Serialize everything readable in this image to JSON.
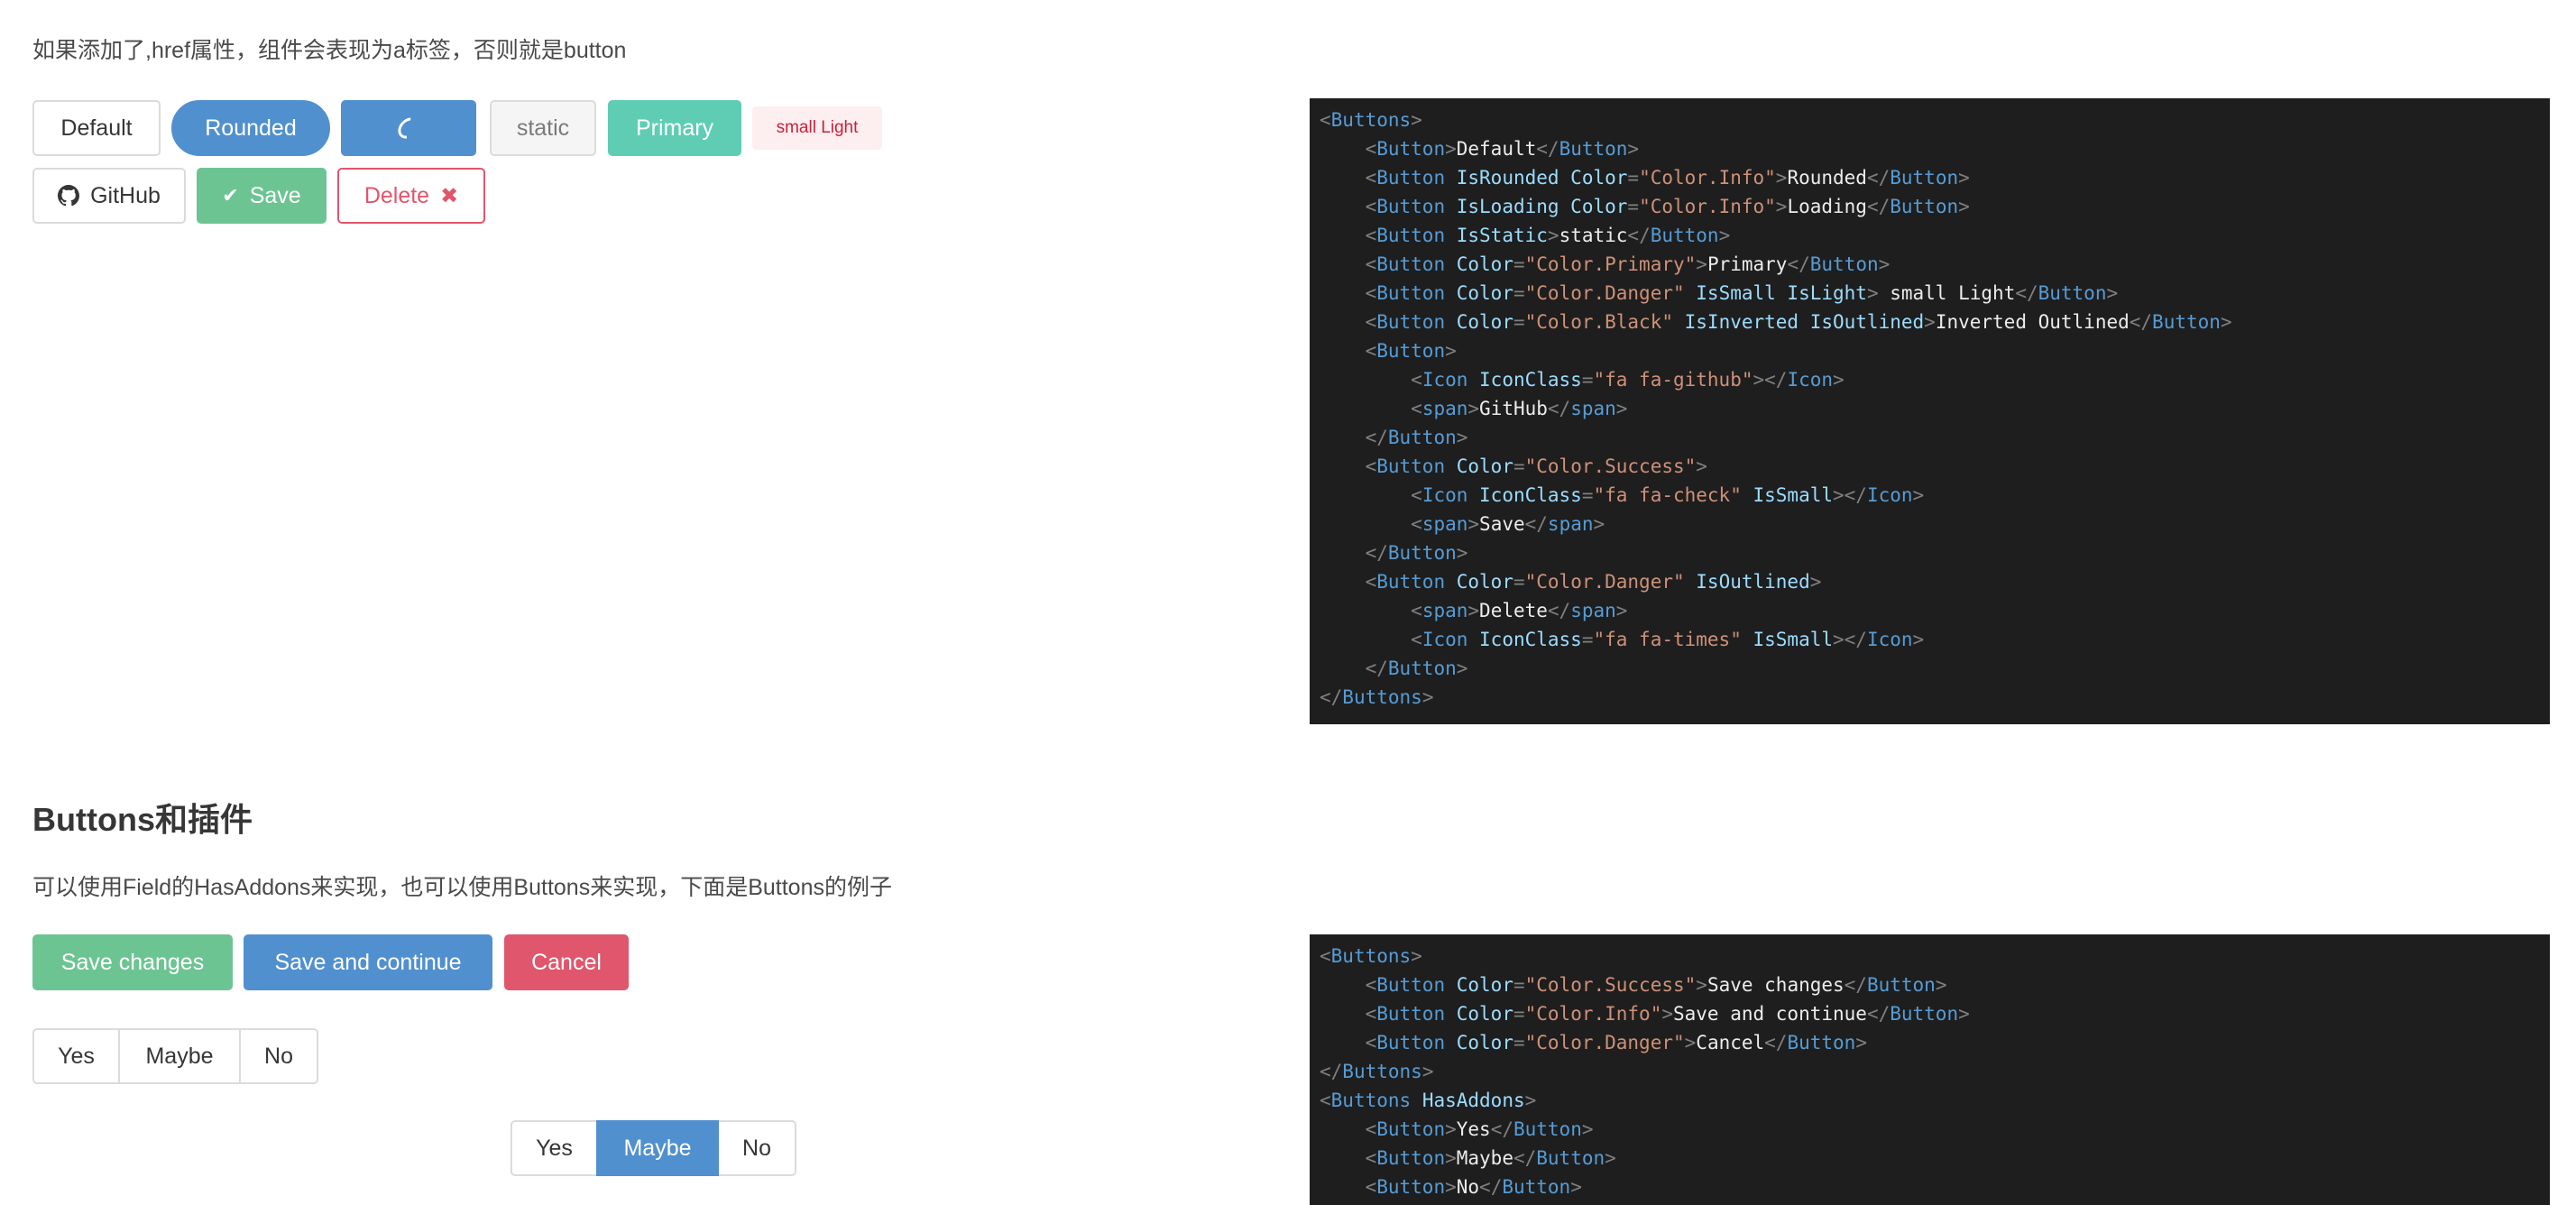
{
  "intro_text": "如果添加了,href属性，组件会表现为a标签，否则就是button",
  "row1": {
    "default": "Default",
    "rounded": "Rounded",
    "static": "static",
    "primary": "Primary",
    "small_light": "small Light"
  },
  "row2": {
    "github": "GitHub",
    "save": "Save",
    "delete": "Delete"
  },
  "section2": {
    "title": "Buttons和插件",
    "desc": "可以使用Field的HasAddons来实现，也可以使用Buttons来实现，下面是Buttons的例子"
  },
  "row3": {
    "save_changes": "Save changes",
    "save_continue": "Save and continue",
    "cancel": "Cancel"
  },
  "addons1": [
    "Yes",
    "Maybe",
    "No"
  ],
  "addons2": {
    "items": [
      "Yes",
      "Maybe",
      "No"
    ],
    "selected": "Maybe"
  },
  "colors": {
    "info": "#5190ce",
    "success": "#6dc493",
    "primary": "#5ecdb4",
    "danger": "#e0566c",
    "code_bg": "#1e1e1e"
  },
  "code1": [
    [
      0,
      [
        [
          "p",
          "<"
        ],
        [
          "t",
          "Buttons"
        ],
        [
          "p",
          ">"
        ]
      ]
    ],
    [
      1,
      [
        [
          "p",
          "<"
        ],
        [
          "t",
          "Button"
        ],
        [
          "p",
          ">"
        ],
        [
          "x",
          "Default"
        ],
        [
          "p",
          "</"
        ],
        [
          "t",
          "Button"
        ],
        [
          "p",
          ">"
        ]
      ]
    ],
    [
      1,
      [
        [
          "p",
          "<"
        ],
        [
          "t",
          "Button "
        ],
        [
          "a",
          "IsRounded Color"
        ],
        [
          "p",
          "="
        ],
        [
          "s",
          "\"Color.Info\""
        ],
        [
          "p",
          ">"
        ],
        [
          "x",
          "Rounded"
        ],
        [
          "p",
          "</"
        ],
        [
          "t",
          "Button"
        ],
        [
          "p",
          ">"
        ]
      ]
    ],
    [
      1,
      [
        [
          "p",
          "<"
        ],
        [
          "t",
          "Button "
        ],
        [
          "a",
          "IsLoading Color"
        ],
        [
          "p",
          "="
        ],
        [
          "s",
          "\"Color.Info\""
        ],
        [
          "p",
          ">"
        ],
        [
          "x",
          "Loading"
        ],
        [
          "p",
          "</"
        ],
        [
          "t",
          "Button"
        ],
        [
          "p",
          ">"
        ]
      ]
    ],
    [
      1,
      [
        [
          "p",
          "<"
        ],
        [
          "t",
          "Button "
        ],
        [
          "a",
          "IsStatic"
        ],
        [
          "p",
          ">"
        ],
        [
          "x",
          "static"
        ],
        [
          "p",
          "</"
        ],
        [
          "t",
          "Button"
        ],
        [
          "p",
          ">"
        ]
      ]
    ],
    [
      1,
      [
        [
          "p",
          "<"
        ],
        [
          "t",
          "Button "
        ],
        [
          "a",
          "Color"
        ],
        [
          "p",
          "="
        ],
        [
          "s",
          "\"Color.Primary\""
        ],
        [
          "p",
          ">"
        ],
        [
          "x",
          "Primary"
        ],
        [
          "p",
          "</"
        ],
        [
          "t",
          "Button"
        ],
        [
          "p",
          ">"
        ]
      ]
    ],
    [
      1,
      [
        [
          "p",
          "<"
        ],
        [
          "t",
          "Button "
        ],
        [
          "a",
          "Color"
        ],
        [
          "p",
          "="
        ],
        [
          "s",
          "\"Color.Danger\" "
        ],
        [
          "a",
          "IsSmall IsLight"
        ],
        [
          "p",
          ">"
        ],
        [
          "x",
          " small Light"
        ],
        [
          "p",
          "</"
        ],
        [
          "t",
          "Button"
        ],
        [
          "p",
          ">"
        ]
      ]
    ],
    [
      1,
      [
        [
          "p",
          "<"
        ],
        [
          "t",
          "Button "
        ],
        [
          "a",
          "Color"
        ],
        [
          "p",
          "="
        ],
        [
          "s",
          "\"Color.Black\" "
        ],
        [
          "a",
          "IsInverted IsOutlined"
        ],
        [
          "p",
          ">"
        ],
        [
          "x",
          "Inverted Outlined"
        ],
        [
          "p",
          "</"
        ],
        [
          "t",
          "Button"
        ],
        [
          "p",
          ">"
        ]
      ]
    ],
    [
      1,
      [
        [
          "p",
          "<"
        ],
        [
          "t",
          "Button"
        ],
        [
          "p",
          ">"
        ]
      ]
    ],
    [
      2,
      [
        [
          "p",
          "<"
        ],
        [
          "t",
          "Icon "
        ],
        [
          "a",
          "IconClass"
        ],
        [
          "p",
          "="
        ],
        [
          "s",
          "\"fa fa-github\""
        ],
        [
          "p",
          "></"
        ],
        [
          "t",
          "Icon"
        ],
        [
          "p",
          ">"
        ]
      ]
    ],
    [
      2,
      [
        [
          "p",
          "<"
        ],
        [
          "t",
          "span"
        ],
        [
          "p",
          ">"
        ],
        [
          "x",
          "GitHub"
        ],
        [
          "p",
          "</"
        ],
        [
          "t",
          "span"
        ],
        [
          "p",
          ">"
        ]
      ]
    ],
    [
      1,
      [
        [
          "p",
          "</"
        ],
        [
          "t",
          "Button"
        ],
        [
          "p",
          ">"
        ]
      ]
    ],
    [
      1,
      [
        [
          "p",
          "<"
        ],
        [
          "t",
          "Button "
        ],
        [
          "a",
          "Color"
        ],
        [
          "p",
          "="
        ],
        [
          "s",
          "\"Color.Success\""
        ],
        [
          "p",
          ">"
        ]
      ]
    ],
    [
      2,
      [
        [
          "p",
          "<"
        ],
        [
          "t",
          "Icon "
        ],
        [
          "a",
          "IconClass"
        ],
        [
          "p",
          "="
        ],
        [
          "s",
          "\"fa fa-check\" "
        ],
        [
          "a",
          "IsSmall"
        ],
        [
          "p",
          "></"
        ],
        [
          "t",
          "Icon"
        ],
        [
          "p",
          ">"
        ]
      ]
    ],
    [
      2,
      [
        [
          "p",
          "<"
        ],
        [
          "t",
          "span"
        ],
        [
          "p",
          ">"
        ],
        [
          "x",
          "Save"
        ],
        [
          "p",
          "</"
        ],
        [
          "t",
          "span"
        ],
        [
          "p",
          ">"
        ]
      ]
    ],
    [
      1,
      [
        [
          "p",
          "</"
        ],
        [
          "t",
          "Button"
        ],
        [
          "p",
          ">"
        ]
      ]
    ],
    [
      1,
      [
        [
          "p",
          "<"
        ],
        [
          "t",
          "Button "
        ],
        [
          "a",
          "Color"
        ],
        [
          "p",
          "="
        ],
        [
          "s",
          "\"Color.Danger\" "
        ],
        [
          "a",
          "IsOutlined"
        ],
        [
          "p",
          ">"
        ]
      ]
    ],
    [
      2,
      [
        [
          "p",
          "<"
        ],
        [
          "t",
          "span"
        ],
        [
          "p",
          ">"
        ],
        [
          "x",
          "Delete"
        ],
        [
          "p",
          "</"
        ],
        [
          "t",
          "span"
        ],
        [
          "p",
          ">"
        ]
      ]
    ],
    [
      2,
      [
        [
          "p",
          "<"
        ],
        [
          "t",
          "Icon "
        ],
        [
          "a",
          "IconClass"
        ],
        [
          "p",
          "="
        ],
        [
          "s",
          "\"fa fa-times\" "
        ],
        [
          "a",
          "IsSmall"
        ],
        [
          "p",
          "></"
        ],
        [
          "t",
          "Icon"
        ],
        [
          "p",
          ">"
        ]
      ]
    ],
    [
      1,
      [
        [
          "p",
          "</"
        ],
        [
          "t",
          "Button"
        ],
        [
          "p",
          ">"
        ]
      ]
    ],
    [
      0,
      [
        [
          "p",
          "</"
        ],
        [
          "t",
          "Buttons"
        ],
        [
          "p",
          ">"
        ]
      ]
    ]
  ],
  "code2": [
    [
      0,
      [
        [
          "p",
          "<"
        ],
        [
          "t",
          "Buttons"
        ],
        [
          "p",
          ">"
        ]
      ]
    ],
    [
      1,
      [
        [
          "p",
          "<"
        ],
        [
          "t",
          "Button "
        ],
        [
          "a",
          "Color"
        ],
        [
          "p",
          "="
        ],
        [
          "s",
          "\"Color.Success\""
        ],
        [
          "p",
          ">"
        ],
        [
          "x",
          "Save changes"
        ],
        [
          "p",
          "</"
        ],
        [
          "t",
          "Button"
        ],
        [
          "p",
          ">"
        ]
      ]
    ],
    [
      1,
      [
        [
          "p",
          "<"
        ],
        [
          "t",
          "Button "
        ],
        [
          "a",
          "Color"
        ],
        [
          "p",
          "="
        ],
        [
          "s",
          "\"Color.Info\""
        ],
        [
          "p",
          ">"
        ],
        [
          "x",
          "Save and continue"
        ],
        [
          "p",
          "</"
        ],
        [
          "t",
          "Button"
        ],
        [
          "p",
          ">"
        ]
      ]
    ],
    [
      1,
      [
        [
          "p",
          "<"
        ],
        [
          "t",
          "Button "
        ],
        [
          "a",
          "Color"
        ],
        [
          "p",
          "="
        ],
        [
          "s",
          "\"Color.Danger\""
        ],
        [
          "p",
          ">"
        ],
        [
          "x",
          "Cancel"
        ],
        [
          "p",
          "</"
        ],
        [
          "t",
          "Button"
        ],
        [
          "p",
          ">"
        ]
      ]
    ],
    [
      0,
      [
        [
          "p",
          "</"
        ],
        [
          "t",
          "Buttons"
        ],
        [
          "p",
          ">"
        ]
      ]
    ],
    [
      0,
      [
        [
          "p",
          "<"
        ],
        [
          "t",
          "Buttons "
        ],
        [
          "a",
          "HasAddons"
        ],
        [
          "p",
          ">"
        ]
      ]
    ],
    [
      1,
      [
        [
          "p",
          "<"
        ],
        [
          "t",
          "Button"
        ],
        [
          "p",
          ">"
        ],
        [
          "x",
          "Yes"
        ],
        [
          "p",
          "</"
        ],
        [
          "t",
          "Button"
        ],
        [
          "p",
          ">"
        ]
      ]
    ],
    [
      1,
      [
        [
          "p",
          "<"
        ],
        [
          "t",
          "Button"
        ],
        [
          "p",
          ">"
        ],
        [
          "x",
          "Maybe"
        ],
        [
          "p",
          "</"
        ],
        [
          "t",
          "Button"
        ],
        [
          "p",
          ">"
        ]
      ]
    ],
    [
      1,
      [
        [
          "p",
          "<"
        ],
        [
          "t",
          "Button"
        ],
        [
          "p",
          ">"
        ],
        [
          "x",
          "No"
        ],
        [
          "p",
          "</"
        ],
        [
          "t",
          "Button"
        ],
        [
          "p",
          ">"
        ]
      ]
    ]
  ]
}
